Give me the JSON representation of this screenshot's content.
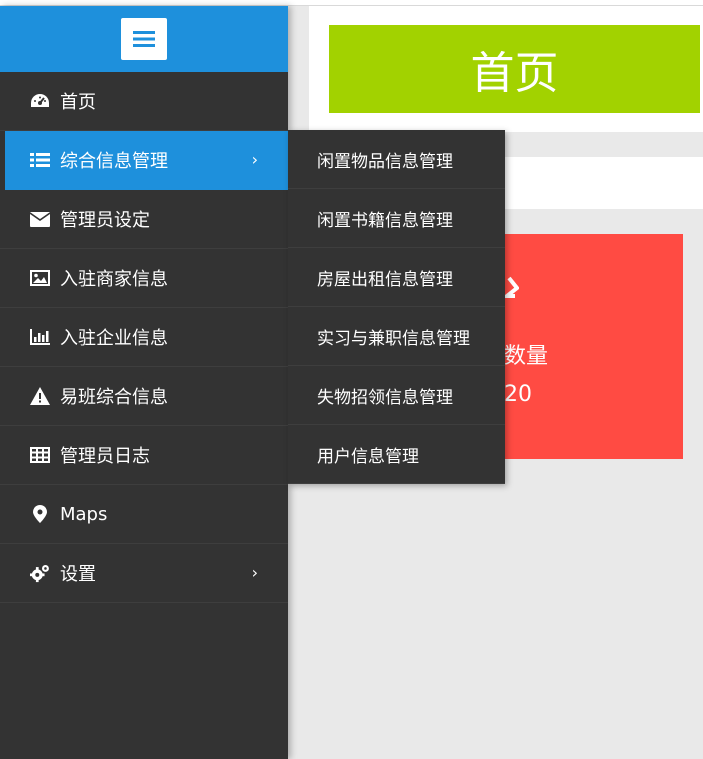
{
  "main": {
    "title": "首页",
    "stat_card": {
      "label": "数量",
      "value": "20"
    }
  },
  "sidebar": {
    "items": [
      {
        "label": "首页",
        "icon": "dashboard-icon"
      },
      {
        "label": "综合信息管理",
        "icon": "list-icon",
        "active": true
      },
      {
        "label": "管理员设定",
        "icon": "envelope-icon"
      },
      {
        "label": "入驻商家信息",
        "icon": "image-icon"
      },
      {
        "label": "入驻企业信息",
        "icon": "bar-chart-icon"
      },
      {
        "label": "易班综合信息",
        "icon": "warning-icon"
      },
      {
        "label": "管理员日志",
        "icon": "table-icon"
      },
      {
        "label": "Maps",
        "icon": "map-marker-icon"
      },
      {
        "label": "设置",
        "icon": "gears-icon"
      }
    ]
  },
  "submenu": {
    "items": [
      {
        "label": "闲置物品信息管理"
      },
      {
        "label": "闲置书籍信息管理"
      },
      {
        "label": "房屋出租信息管理"
      },
      {
        "label": "实习与兼职信息管理"
      },
      {
        "label": "失物招领信息管理"
      },
      {
        "label": "用户信息管理"
      }
    ]
  },
  "colors": {
    "sidebar_bg": "#333333",
    "accent_blue": "#1e90dc",
    "title_green": "#a2d200",
    "card_red": "#ff4b43"
  }
}
